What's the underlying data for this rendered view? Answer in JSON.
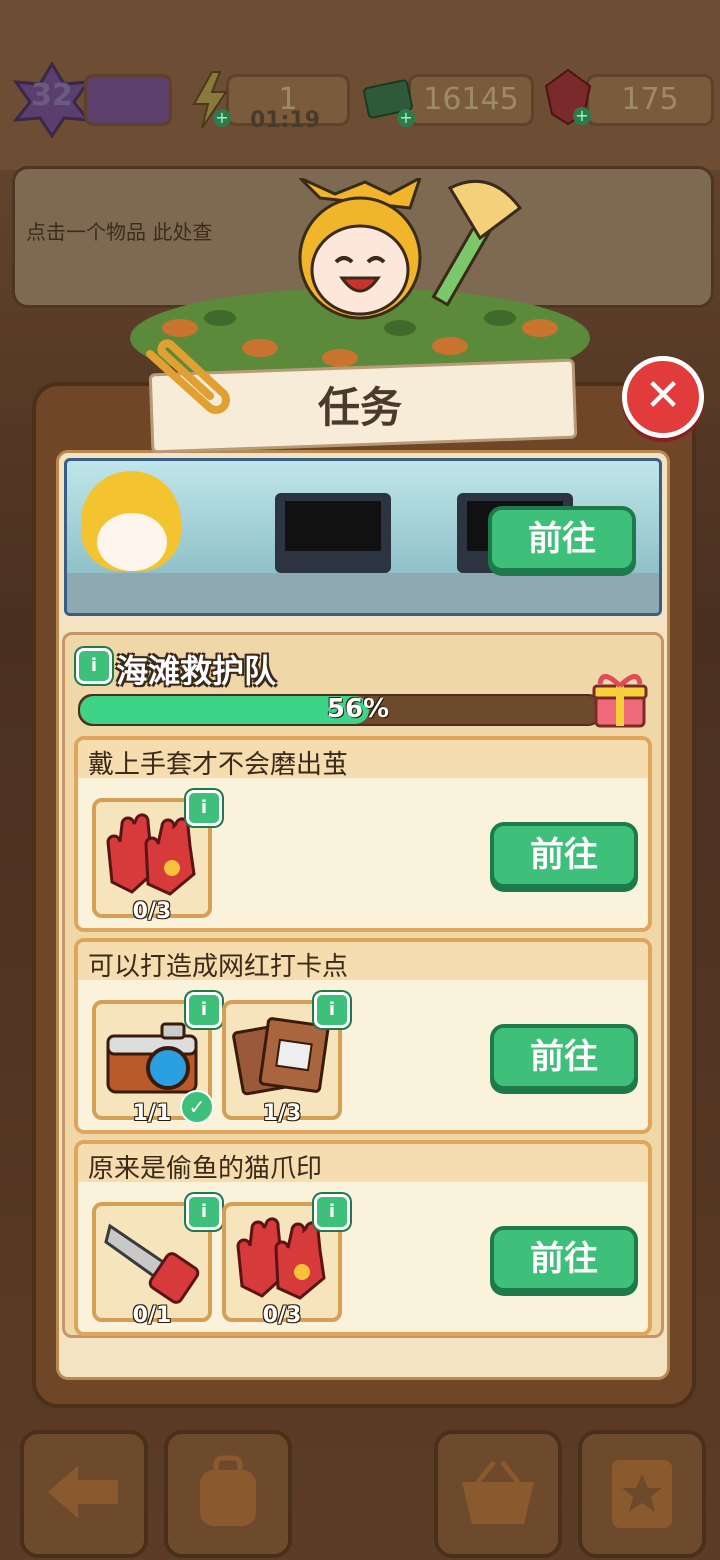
{
  "status_bar": {
    "level": "32",
    "energy": "1",
    "energy_timer": "01:19",
    "cash": "16145",
    "gems": "175"
  },
  "background": {
    "hint_text": "点击一个物品 此处查"
  },
  "dialog": {
    "title": "任务",
    "close_symbol": "✕",
    "banner_button": "前往",
    "team": {
      "name": "海滩救护队",
      "progress_label": "56%",
      "progress": 0.56,
      "info_symbol": "i"
    },
    "tasks": [
      {
        "title": "戴上手套才不会磨出茧",
        "go_label": "前往",
        "items": [
          {
            "icon": "gloves-icon",
            "count": "0/3",
            "done": false
          }
        ]
      },
      {
        "title": "可以打造成网红打卡点",
        "go_label": "前往",
        "items": [
          {
            "icon": "camera-icon",
            "count": "1/1",
            "done": true
          },
          {
            "icon": "photo-frames-icon",
            "count": "1/3",
            "done": false
          }
        ]
      },
      {
        "title": "原来是偷鱼的猫爪印",
        "go_label": "前往",
        "items": [
          {
            "icon": "hand-saw-icon",
            "count": "0/1",
            "done": false
          },
          {
            "icon": "gloves-icon",
            "count": "0/3",
            "done": false
          }
        ]
      }
    ]
  },
  "colors": {
    "accent_green": "#3ec07a",
    "close_red": "#e23b3b",
    "panel_brown": "#6f4628",
    "parchment": "#f4e3c2"
  }
}
